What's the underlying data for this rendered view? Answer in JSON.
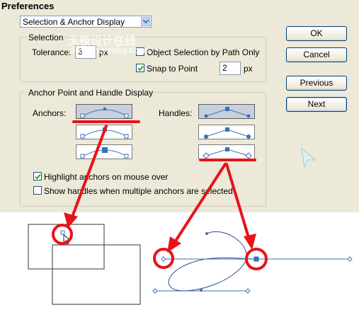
{
  "window": {
    "title": "Preferences"
  },
  "category_select": {
    "value": "Selection & Anchor Display"
  },
  "selection": {
    "legend": "Selection",
    "tolerance_label": "Tolerance:",
    "tolerance_value": "3",
    "tolerance_unit": "px",
    "object_selection_label": "Object Selection by Path Only",
    "object_selection_checked": false,
    "snap_label": "Snap to Point",
    "snap_checked": true,
    "snap_value": "2",
    "snap_unit": "px"
  },
  "anchor": {
    "legend": "Anchor Point and Handle Display",
    "anchors_label": "Anchors:",
    "handles_label": "Handles:",
    "highlight_label": "Highlight anchors on mouse over",
    "highlight_checked": true,
    "show_handles_label": "Show handles when multiple anchors are selected",
    "show_handles_checked": false
  },
  "buttons": {
    "ok": "OK",
    "cancel": "Cancel",
    "previous": "Previous",
    "next": "Next"
  },
  "watermark": {
    "line1": "天极设计在线",
    "line2": "design.yesky.com"
  },
  "colors": {
    "dialog_bg": "#ece9d8",
    "annotation_red": "#e8131a",
    "path_blue": "#3d6fb5"
  }
}
